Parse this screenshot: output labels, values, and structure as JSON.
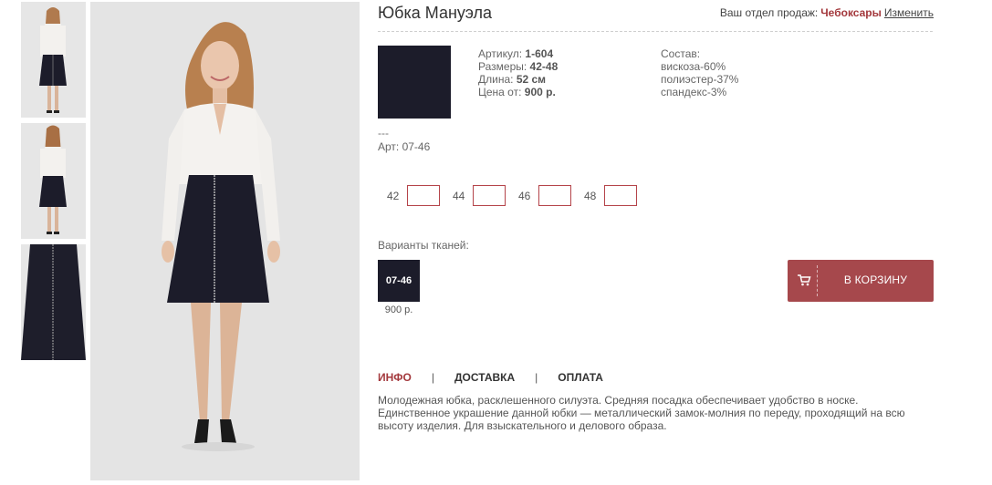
{
  "product": {
    "title": "Юбка Мануэла"
  },
  "header": {
    "dept_label": "Ваш отдел продаж:",
    "city": "Чебоксары",
    "change_link": "Изменить"
  },
  "specs": {
    "article_label": "Артикул:",
    "article_value": "1-604",
    "sizes_label": "Размеры:",
    "sizes_value": "42-48",
    "length_label": "Длина:",
    "length_value": "52 см",
    "price_label": "Цена от:",
    "price_value": "900 р."
  },
  "composition": {
    "label": "Состав:",
    "items": [
      "вискоза-60%",
      "полиэстер-37%",
      "спандекс-3%"
    ]
  },
  "fabric_info": {
    "dashes": "---",
    "art": "Арт: 07-46"
  },
  "sizes": [
    {
      "label": "42"
    },
    {
      "label": "44"
    },
    {
      "label": "46"
    },
    {
      "label": "48"
    }
  ],
  "variants": {
    "label": "Варианты тканей:",
    "items": [
      {
        "code": "07-46",
        "price": "900 р.",
        "color": "#1c1c2a"
      }
    ]
  },
  "cart": {
    "label": "В КОРЗИНУ",
    "color": "#a6484c",
    "icon": "cart-icon"
  },
  "tabs": [
    {
      "label": "ИНФО",
      "active": true
    },
    {
      "label": "ДОСТАВКА",
      "active": false
    },
    {
      "label": "ОПЛАТА",
      "active": false
    }
  ],
  "tab_separator": "|",
  "description": "Молодежная юбка, расклешенного силуэта. Средняя посадка обеспечивает удобство в носке. Единственное украшение данной юбки — металлический замок-молния по переду, проходящий на всю высоту изделия. Для взыскательного и делового образа.",
  "colors": {
    "accent": "#a3383c",
    "swatch": "#1c1c2a"
  }
}
